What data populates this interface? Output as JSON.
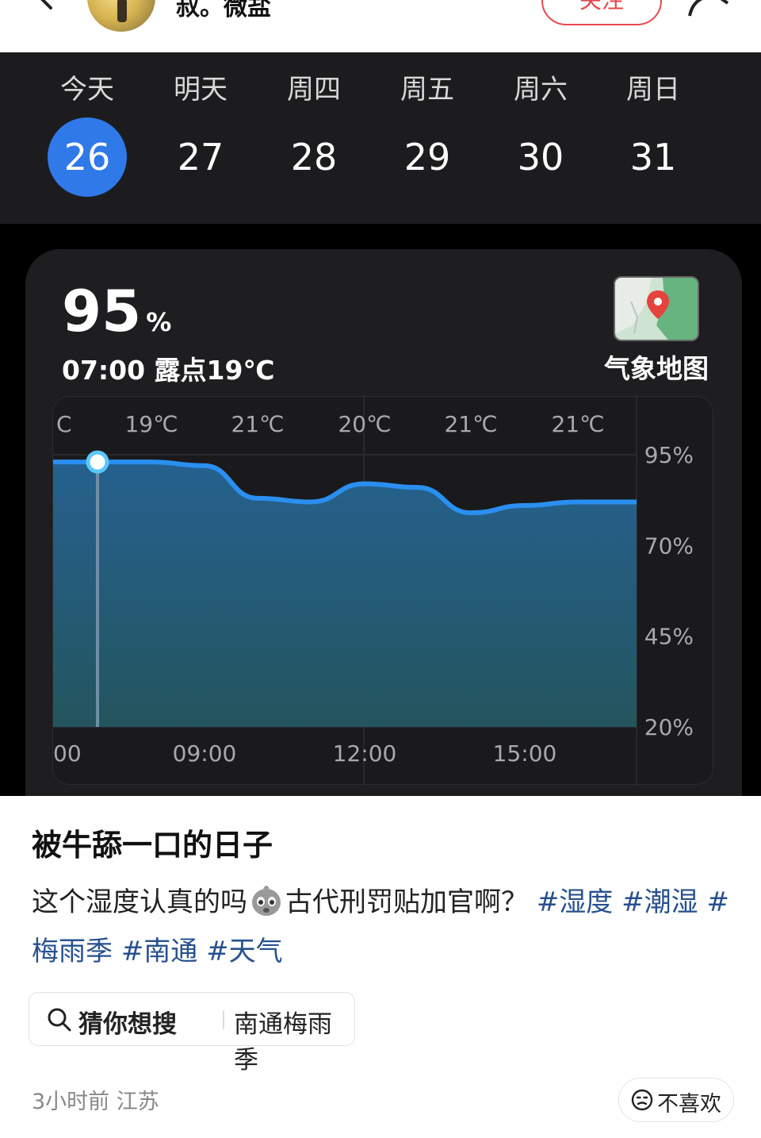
{
  "header": {
    "username": "叔。微盐",
    "follow_label": "关注"
  },
  "days": [
    {
      "name": "今天",
      "date": "26",
      "active": true
    },
    {
      "name": "明天",
      "date": "27"
    },
    {
      "name": "周四",
      "date": "28"
    },
    {
      "name": "周五",
      "date": "29"
    },
    {
      "name": "周六",
      "date": "30"
    },
    {
      "name": "周日",
      "date": "31"
    }
  ],
  "humidity": {
    "value": "95",
    "unit": "%",
    "detail": "07:00 露点19℃",
    "map_label": "气象地图"
  },
  "chart_data": {
    "type": "area",
    "x_tick_labels": [
      "00",
      "09:00",
      "12:00",
      "15:00"
    ],
    "x_hours": [
      6.5,
      7,
      8,
      9,
      10,
      11,
      12,
      13,
      14,
      15,
      16,
      17
    ],
    "values": [
      93,
      93,
      93,
      92,
      83,
      82,
      87,
      86,
      79,
      81,
      82,
      82
    ],
    "dew_point_labels": [
      "C",
      "19℃",
      "21℃",
      "20℃",
      "21℃",
      "21℃"
    ],
    "y_tick_labels": [
      "95%",
      "70%",
      "45%",
      "20%"
    ],
    "ylim": [
      20,
      95
    ],
    "selected_hour": 7,
    "grid": true,
    "colors": {
      "line": "#2a8ff0",
      "fill_top": "#25618f",
      "fill_bottom": "#24555e",
      "marker": "#5ac8fa"
    }
  },
  "post": {
    "title": "被牛舔一口的日子",
    "body_text": "这个湿度认真的吗",
    "body_text2": "古代刑罚贴加官啊？",
    "tags": [
      "#湿度",
      "#潮湿",
      "#梅雨季",
      "#南通",
      "#天气"
    ]
  },
  "search": {
    "label": "猜你想搜",
    "term": "南通梅雨季"
  },
  "meta": {
    "time_location": "3小时前 江苏",
    "dislike_label": "不喜欢"
  }
}
